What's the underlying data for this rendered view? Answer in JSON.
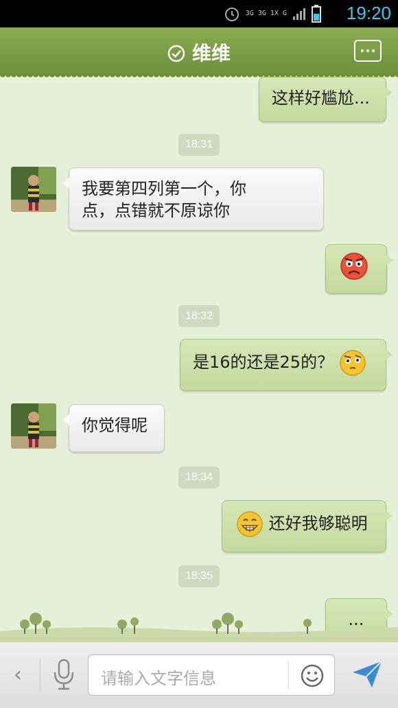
{
  "status_bar": {
    "network_label": "3G 3G 1X G",
    "time": "19:20"
  },
  "header": {
    "title": "维维"
  },
  "messages": [
    {
      "side": "out",
      "text": "这样好尴尬..."
    },
    {
      "side": "in",
      "text_line1": "我要第四列第一个，你",
      "text_line2": "点，点错就不原谅你"
    },
    {
      "side": "out",
      "emoji": "angry-face"
    },
    {
      "side": "out",
      "text": "是16的还是25的？",
      "emoji": "thinking-face"
    },
    {
      "side": "in",
      "text": "你觉得呢"
    },
    {
      "side": "out",
      "text": "还好我够聪明",
      "emoji": "grinning-face"
    },
    {
      "side": "out",
      "text": "..."
    }
  ],
  "timestamps": [
    "18:31",
    "18:32",
    "18:34",
    "18:35"
  ],
  "input": {
    "placeholder": "请输入文字信息"
  },
  "colors": {
    "accent": "#7a9a45",
    "out_bubble": "#c9dda6",
    "in_bubble": "#f3f3f3",
    "background": "#e6efd7"
  }
}
